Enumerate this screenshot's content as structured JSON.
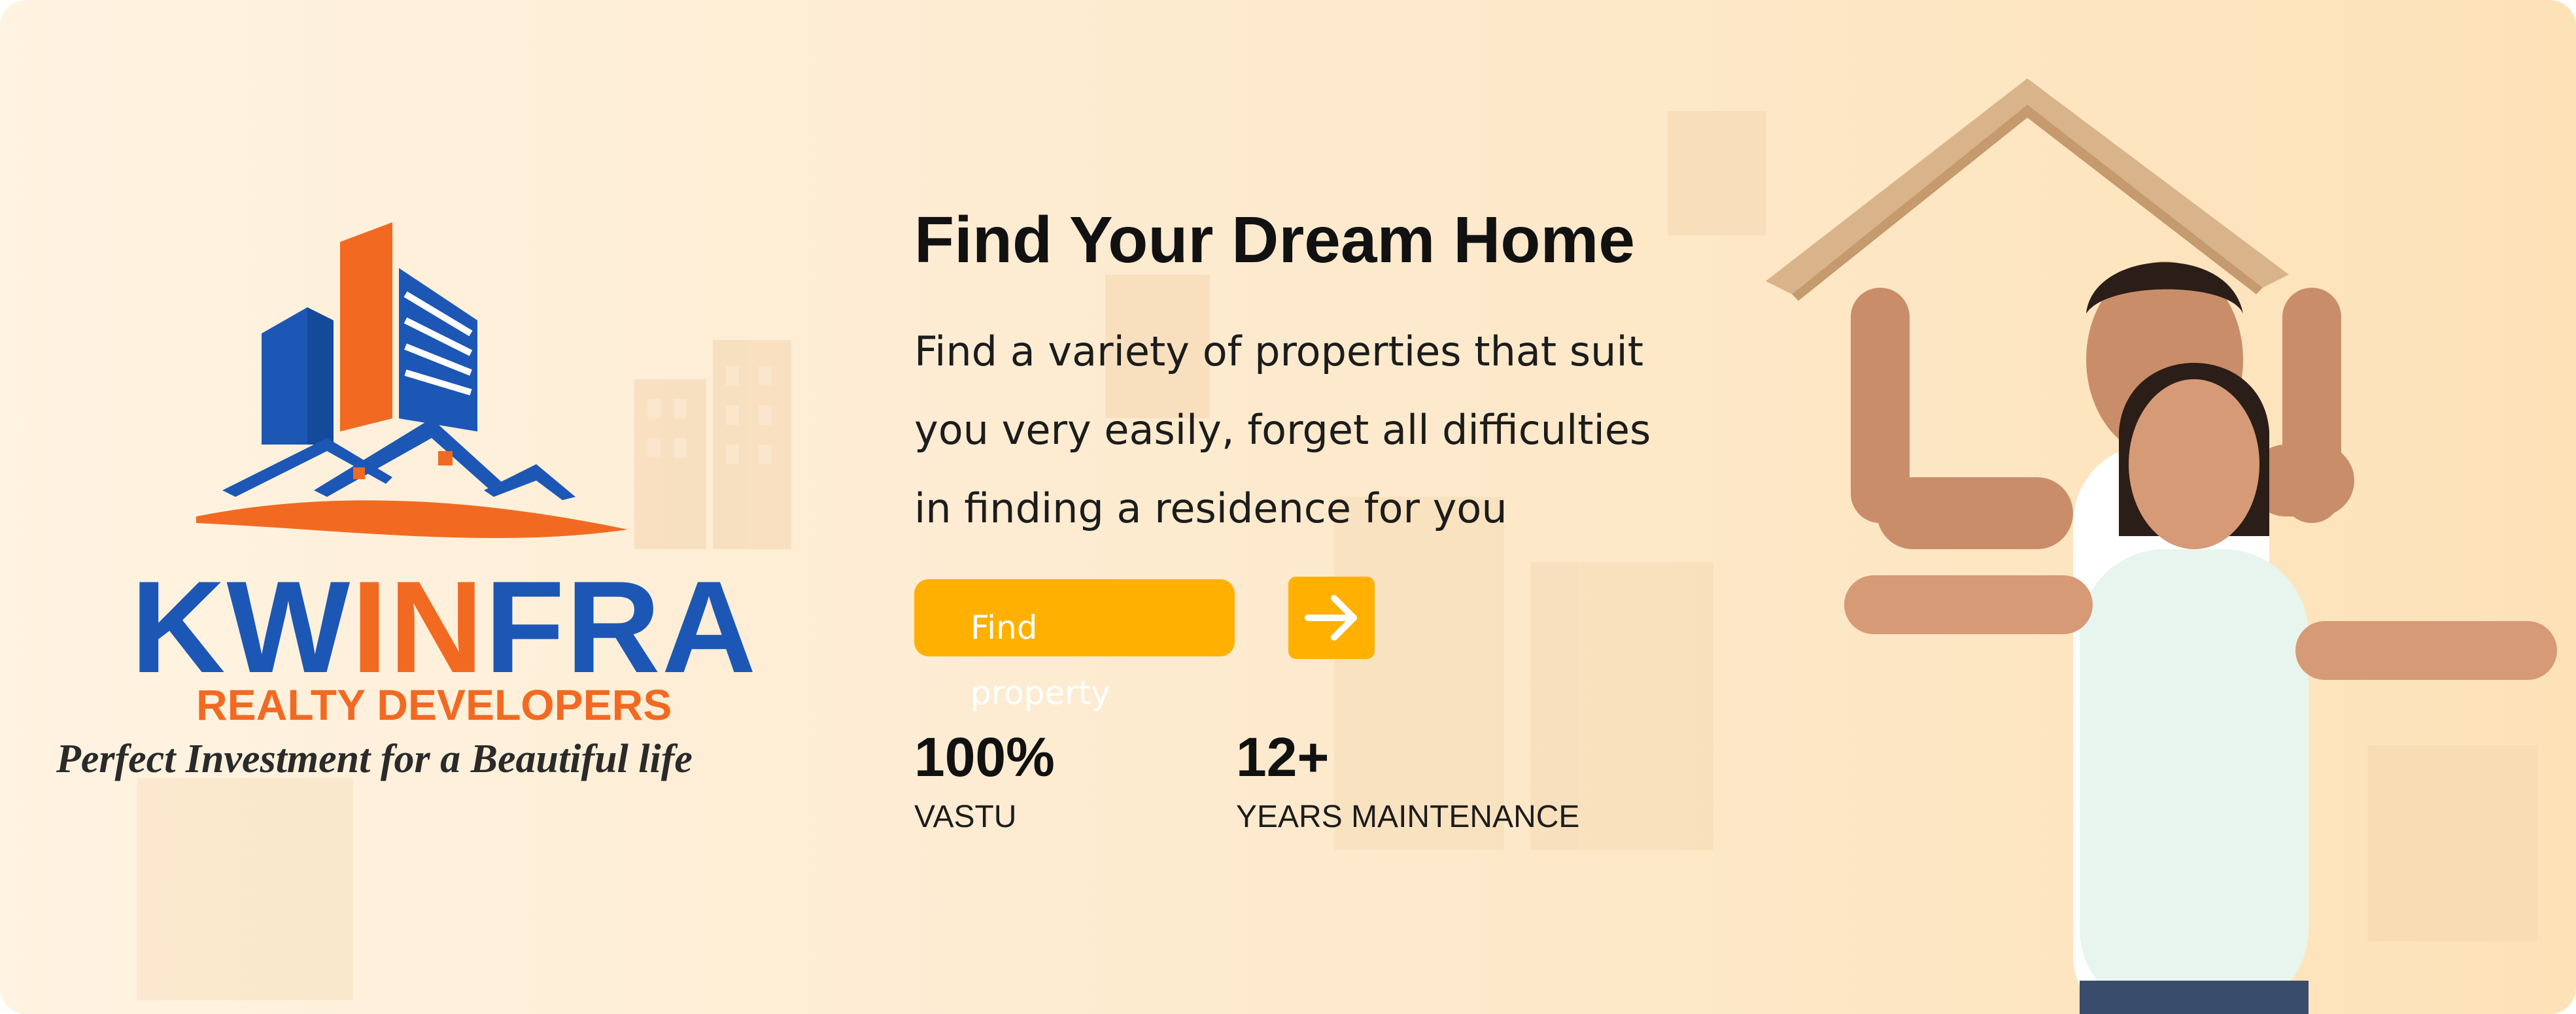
{
  "logo": {
    "brand_part1": "KW",
    "brand_part2": "IN",
    "brand_part3": "FRA",
    "subtitle": "REALTY DEVELOPERS",
    "tagline": "Perfect Investment for a Beautiful life"
  },
  "hero": {
    "title": "Find Your Dream Home",
    "description_lines": [
      "Find a variety of properties that suit",
      "you very easily, forget all difficulties",
      "in finding a residence for you"
    ],
    "find_button_label": "Find property",
    "arrow_button_icon": "arrow-right-icon"
  },
  "stats": [
    {
      "value": "100%",
      "label": "VASTU"
    },
    {
      "value": "12+",
      "label": "YEARS MAINTENANCE"
    }
  ],
  "colors": {
    "accent": "#ffb000",
    "brand_blue": "#1c57b5",
    "brand_orange": "#f26a21",
    "background": "#fdebd0"
  },
  "image": {
    "subject": "couple-under-roof-image"
  }
}
